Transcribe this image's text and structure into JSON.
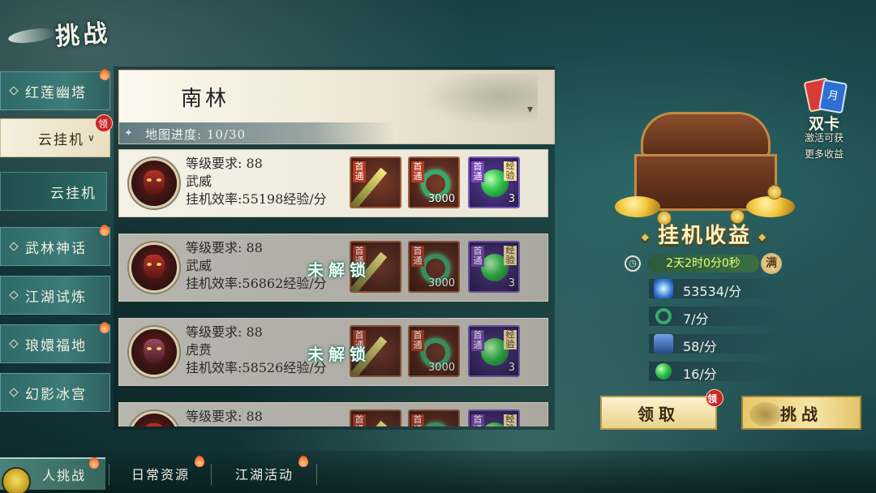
{
  "header": {
    "title": "挑战"
  },
  "sidebar": {
    "items": [
      {
        "label": "红莲幽塔"
      },
      {
        "label": "云挂机",
        "badge": "领"
      },
      {
        "label": "云挂机"
      },
      {
        "label": "武林神话"
      },
      {
        "label": "江湖试炼"
      },
      {
        "label": "琅嬛福地"
      },
      {
        "label": "幻影冰宫"
      }
    ]
  },
  "map": {
    "name": "南林",
    "dropdown_icon": "chevron-down-icon",
    "progress_label": "地图进度: 10/30"
  },
  "stages": [
    {
      "level_req": "等级要求: 88",
      "name": "武威",
      "efficiency": "挂机效率:55198经验/分",
      "locked": false,
      "lock_text": "",
      "rewards": [
        {
          "tag": "首通",
          "kind": "weapon",
          "qty": ""
        },
        {
          "tag": "首通",
          "kind": "jade",
          "qty": "3000"
        },
        {
          "tag": "首通",
          "kind": "exp-orb",
          "exp_tag": "经验",
          "qty": "3"
        }
      ]
    },
    {
      "level_req": "等级要求: 88",
      "name": "武威",
      "efficiency": "挂机效率:56862经验/分",
      "locked": true,
      "lock_text": "未解锁",
      "rewards": [
        {
          "tag": "首通",
          "kind": "weapon",
          "qty": ""
        },
        {
          "tag": "首通",
          "kind": "jade",
          "qty": "3000"
        },
        {
          "tag": "首通",
          "kind": "exp-orb",
          "exp_tag": "经验",
          "qty": "3"
        }
      ]
    },
    {
      "level_req": "等级要求: 88",
      "name": "虎贲",
      "efficiency": "挂机效率:58526经验/分",
      "locked": true,
      "lock_text": "未解锁",
      "rewards": [
        {
          "tag": "首通",
          "kind": "weapon",
          "qty": ""
        },
        {
          "tag": "首通",
          "kind": "jade",
          "qty": "3000"
        },
        {
          "tag": "首通",
          "kind": "exp-orb",
          "exp_tag": "经验",
          "qty": "3"
        }
      ]
    },
    {
      "level_req": "等级要求: 88",
      "name": "",
      "efficiency": "",
      "locked": true,
      "lock_text": "",
      "rewards": [
        {
          "tag": "首通",
          "kind": "weapon",
          "qty": ""
        },
        {
          "tag": "首通",
          "kind": "jade",
          "qty": ""
        },
        {
          "tag": "首通",
          "kind": "exp-orb",
          "exp_tag": "经验",
          "qty": ""
        }
      ]
    }
  ],
  "idle": {
    "title": "挂机收益",
    "timer": "2天2时0分0秒",
    "full_badge": "满",
    "rates": [
      {
        "icon": "exp-wave-icon",
        "value": "53534/分"
      },
      {
        "icon": "jade-coin-icon",
        "value": "7/分"
      },
      {
        "icon": "training-book-icon",
        "value": "58/分"
      },
      {
        "icon": "green-orb-icon",
        "value": "16/分"
      }
    ]
  },
  "card_promo": {
    "title": "双卡",
    "card_label": "月",
    "desc_line1": "激活可获",
    "desc_line2": "更多收益"
  },
  "actions": {
    "claim_label": "领取",
    "claim_badge": "领",
    "challenge_label": "挑战"
  },
  "bottom_tabs": [
    {
      "label": "人挑战",
      "active": true
    },
    {
      "label": "日常资源",
      "active": false
    },
    {
      "label": "江湖活动",
      "active": false
    }
  ],
  "colors": {
    "badge_red": "#c8262a",
    "timer_text": "#e6ff7a",
    "lock_text_glow": "#1d6f5a"
  }
}
